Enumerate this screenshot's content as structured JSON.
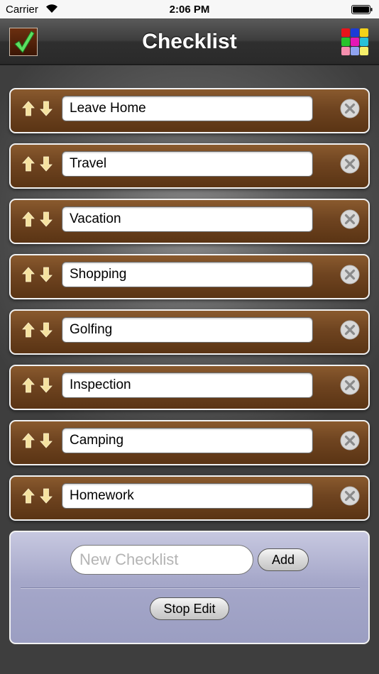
{
  "status_bar": {
    "carrier": "Carrier",
    "time": "2:06 PM"
  },
  "nav": {
    "title": "Checklist",
    "left_icon": "checkmark-icon",
    "right_icon": "color-grid-icon"
  },
  "colors": {
    "grid": [
      "#e8141b",
      "#1a3cd6",
      "#f3d21a",
      "#27c32b",
      "#e417b5",
      "#28c0d8",
      "#f58fae",
      "#8fa3f0",
      "#f5ee6a"
    ],
    "row_brown": "#6f4420",
    "panel_lavender": "#a5a7c9"
  },
  "checklists": [
    {
      "name": "Leave Home"
    },
    {
      "name": "Travel"
    },
    {
      "name": "Vacation"
    },
    {
      "name": "Shopping"
    },
    {
      "name": "Golfing"
    },
    {
      "name": "Inspection"
    },
    {
      "name": "Camping"
    },
    {
      "name": "Homework"
    }
  ],
  "add_panel": {
    "placeholder": "New Checklist",
    "add_label": "Add",
    "stop_edit_label": "Stop Edit"
  }
}
